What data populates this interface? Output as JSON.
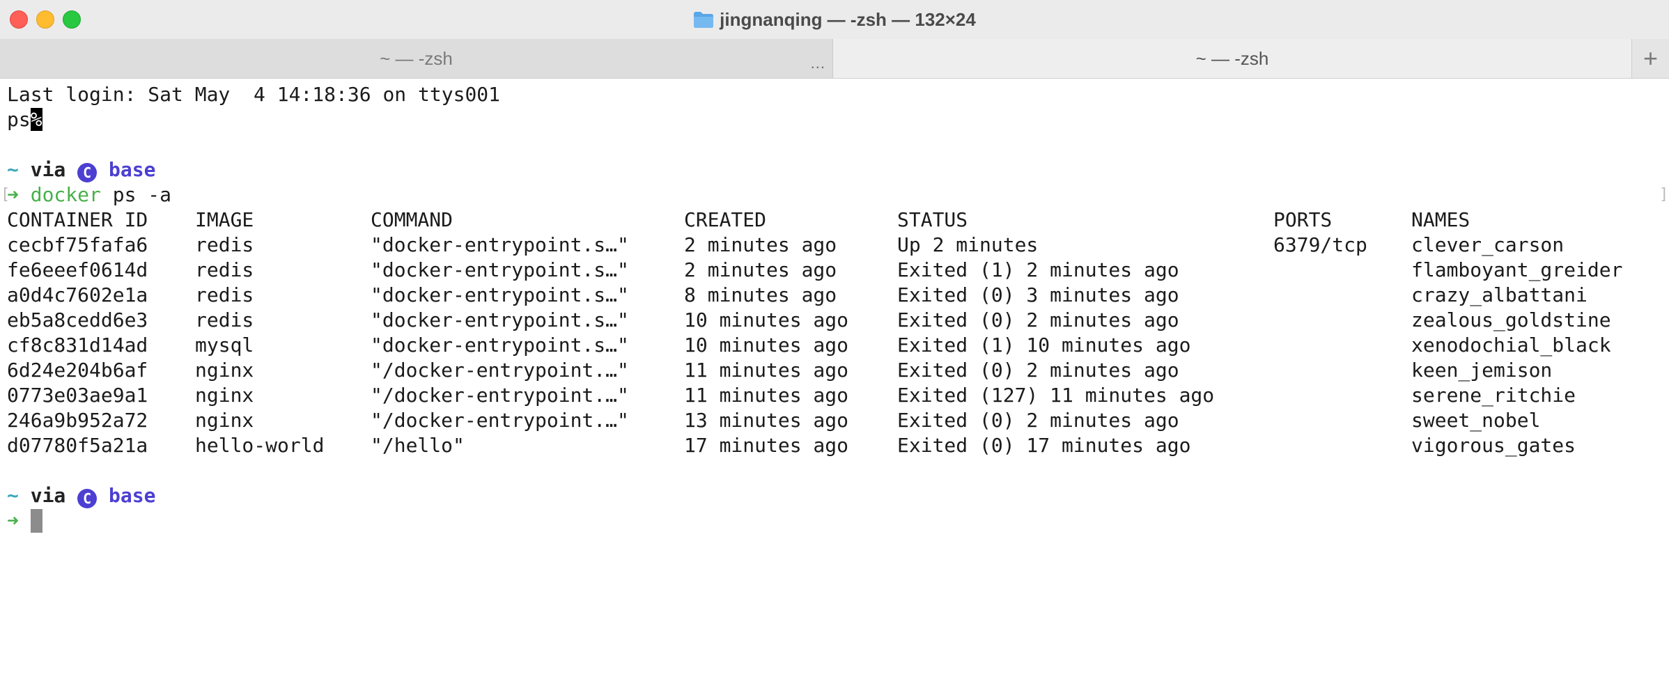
{
  "window": {
    "title": "jingnanqing — -zsh — 132×24",
    "folder_icon": "folder-icon",
    "colors": {
      "close": "#fe5f57",
      "minimize": "#febc2e",
      "maximize": "#28c840"
    }
  },
  "tabs": [
    {
      "label": "~ — -zsh",
      "more": "..."
    },
    {
      "label": "~ — -zsh"
    }
  ],
  "tab_add": "+",
  "terminal": {
    "last_login": "Last login: Sat May  4 14:18:36 on ttys001",
    "ps_prefix": "ps",
    "ps_percent": "%",
    "prompt1": {
      "tilde": "~",
      "via": "via",
      "conda_icon": "C",
      "env": "base"
    },
    "command": {
      "arrow": "➜",
      "cmd": "docker",
      "args": "ps -a",
      "bracket_l": "[",
      "bracket_r": "]"
    },
    "table": {
      "headers": [
        "CONTAINER ID",
        "IMAGE",
        "COMMAND",
        "CREATED",
        "STATUS",
        "PORTS",
        "NAMES"
      ],
      "rows": [
        [
          "cecbf75fafa6",
          "redis",
          "\"docker-entrypoint.s…\"",
          "2 minutes ago",
          "Up 2 minutes",
          "6379/tcp",
          "clever_carson"
        ],
        [
          "fe6eeef0614d",
          "redis",
          "\"docker-entrypoint.s…\"",
          "2 minutes ago",
          "Exited (1) 2 minutes ago",
          "",
          "flamboyant_greider"
        ],
        [
          "a0d4c7602e1a",
          "redis",
          "\"docker-entrypoint.s…\"",
          "8 minutes ago",
          "Exited (0) 3 minutes ago",
          "",
          "crazy_albattani"
        ],
        [
          "eb5a8cedd6e3",
          "redis",
          "\"docker-entrypoint.s…\"",
          "10 minutes ago",
          "Exited (0) 2 minutes ago",
          "",
          "zealous_goldstine"
        ],
        [
          "cf8c831d14ad",
          "mysql",
          "\"docker-entrypoint.s…\"",
          "10 minutes ago",
          "Exited (1) 10 minutes ago",
          "",
          "xenodochial_black"
        ],
        [
          "6d24e204b6af",
          "nginx",
          "\"/docker-entrypoint.…\"",
          "11 minutes ago",
          "Exited (0) 2 minutes ago",
          "",
          "keen_jemison"
        ],
        [
          "0773e03ae9a1",
          "nginx",
          "\"/docker-entrypoint.…\"",
          "11 minutes ago",
          "Exited (127) 11 minutes ago",
          "",
          "serene_ritchie"
        ],
        [
          "246a9b952a72",
          "nginx",
          "\"/docker-entrypoint.…\"",
          "13 minutes ago",
          "Exited (0) 2 minutes ago",
          "",
          "sweet_nobel"
        ],
        [
          "d07780f5a21a",
          "hello-world",
          "\"/hello\"",
          "17 minutes ago",
          "Exited (0) 17 minutes ago",
          "",
          "vigorous_gates"
        ]
      ]
    },
    "prompt2": {
      "tilde": "~",
      "via": "via",
      "conda_icon": "C",
      "env": "base",
      "arrow": "➜"
    }
  }
}
